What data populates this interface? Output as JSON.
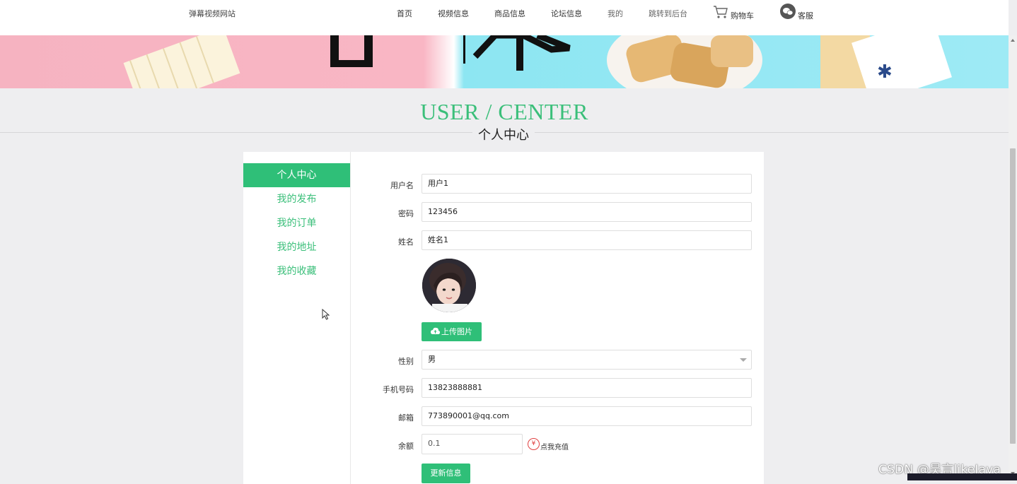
{
  "header": {
    "site_name": "弹幕视频网站",
    "nav": {
      "home": "首页",
      "video_info": "视频信息",
      "goods_info": "商品信息",
      "forum_info": "论坛信息",
      "mine": "我的",
      "admin": "跳转到后台",
      "cart": "购物车",
      "service": "客服"
    }
  },
  "section": {
    "title": "USER / CENTER",
    "subtitle": "个人中心"
  },
  "sidebar": {
    "items": [
      {
        "label": "个人中心",
        "active": true
      },
      {
        "label": "我的发布",
        "active": false
      },
      {
        "label": "我的订单",
        "active": false
      },
      {
        "label": "我的地址",
        "active": false
      },
      {
        "label": "我的收藏",
        "active": false
      }
    ]
  },
  "form": {
    "username": {
      "label": "用户名",
      "value": "用户1"
    },
    "password": {
      "label": "密码",
      "value": "123456"
    },
    "name": {
      "label": "姓名",
      "value": "姓名1"
    },
    "upload_button": "上传图片",
    "gender": {
      "label": "性别",
      "value": "男"
    },
    "phone": {
      "label": "手机号码",
      "value": "13823888881"
    },
    "email": {
      "label": "邮箱",
      "value": "773890001@qq.com"
    },
    "balance": {
      "label": "余额",
      "value": "0.1"
    },
    "recharge_link": "点我充值",
    "update_button": "更新信息"
  },
  "colors": {
    "accent": "#2fbf78",
    "title_green": "#3bbf7a",
    "background": "#eeeef0"
  },
  "watermark": "CSDN @昊言likeJava"
}
